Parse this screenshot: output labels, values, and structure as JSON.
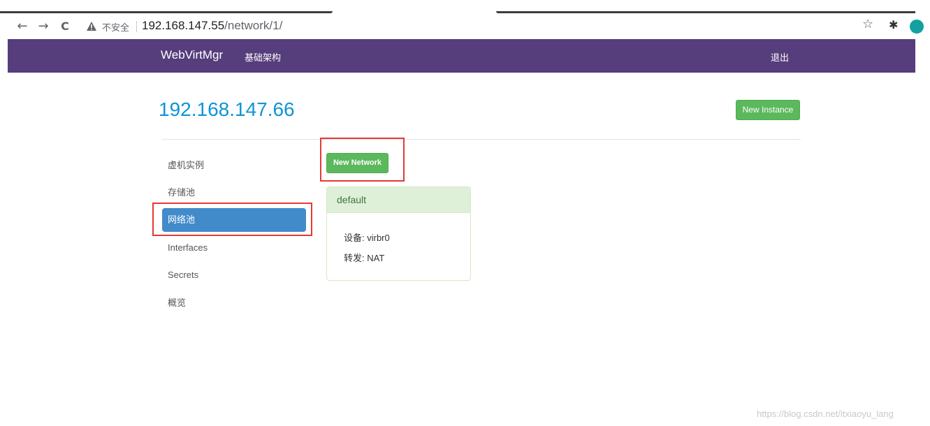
{
  "browser": {
    "back_icon": "←",
    "forward_icon": "→",
    "reload_icon": "C",
    "insecure_label": "不安全",
    "url_host": "192.168.147.55",
    "url_path": "/network/1/",
    "star_icon": "☆",
    "extensions_icon": "✱"
  },
  "navbar": {
    "brand": "WebVirtMgr",
    "infrastructure_link": "基础架构",
    "logout_link": "退出",
    "background_color": "#563d7c"
  },
  "header": {
    "host_title": "192.168.147.66",
    "new_instance_label": "New Instance"
  },
  "sidebar": {
    "items": [
      {
        "label": "虚机实例",
        "active": false
      },
      {
        "label": "存储池",
        "active": false
      },
      {
        "label": "网络池",
        "active": true
      },
      {
        "label": "Interfaces",
        "active": false
      },
      {
        "label": "Secrets",
        "active": false
      },
      {
        "label": "概览",
        "active": false
      }
    ]
  },
  "main": {
    "new_network_label": "New Network",
    "networks": [
      {
        "name": "default",
        "device_line": "设备: virbr0",
        "forward_line": "转发: NAT"
      }
    ]
  },
  "watermark": "https://blog.csdn.net/itxiaoyu_lang",
  "colors": {
    "accent_blue": "#0d94d6",
    "success_green": "#5cb85c",
    "active_blue": "#428bca",
    "highlight_red": "#e53935"
  }
}
